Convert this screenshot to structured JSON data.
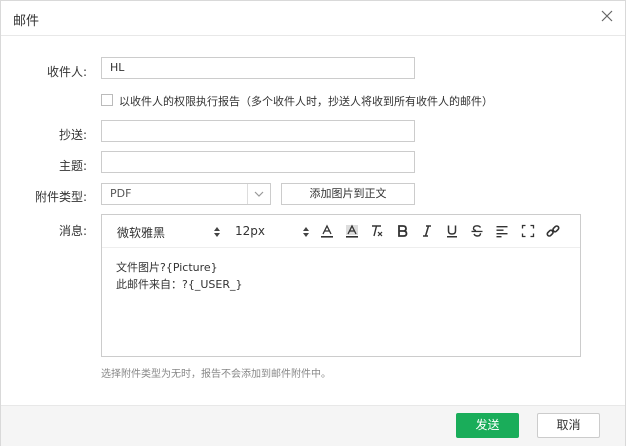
{
  "dialog": {
    "title": "邮件"
  },
  "form": {
    "recipient_label": "收件人:",
    "recipient_value": "HL",
    "permission_checkbox_label": "以收件人的权限执行报告（多个收件人时，抄送人将收到所有收件人的邮件）",
    "cc_label": "抄送:",
    "cc_value": "",
    "subject_label": "主题:",
    "subject_value": "",
    "attachment_label": "附件类型:",
    "attachment_selected": "PDF",
    "add_image_button": "添加图片到正文",
    "message_label": "消息:",
    "hint": "选择附件类型为无时，报告不会添加到邮件附件中。"
  },
  "editor": {
    "font_family": "微软雅黑",
    "font_size": "12px",
    "lines": [
      "文件图片?{Picture}",
      "此邮件来自：?{_USER_}"
    ]
  },
  "footer": {
    "send": "发送",
    "cancel": "取消"
  },
  "colors": {
    "primary": "#1aad5a",
    "border": "#cccccc",
    "footer_bg": "#f5f5f5"
  }
}
